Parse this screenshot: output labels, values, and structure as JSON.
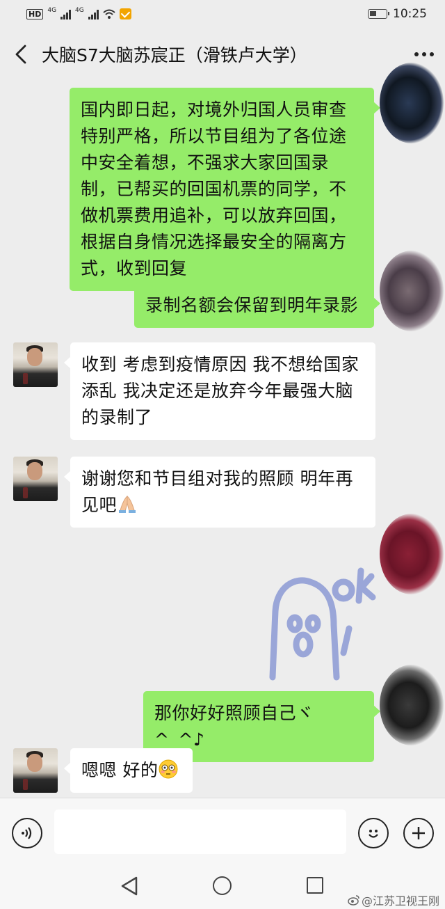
{
  "status_bar": {
    "hd": "HD",
    "hd_sub": "2",
    "net1": "4G",
    "net2": "4G",
    "time": "10:25"
  },
  "header": {
    "title": "大脑S7大脑苏宸正（滑铁卢大学）",
    "back_icon": "chevron-left-icon",
    "more_icon": "more-dots-icon"
  },
  "messages": [
    {
      "side": "right",
      "text": "国内即日起，对境外归国人员审查特别严格，所以节目组为了各位途中安全着想，不强求大家回国录制，已帮买的回国机票的同学，不做机票费用追补，可以放弃回国，根据自身情况选择最安全的隔离方式，收到回复"
    },
    {
      "side": "right",
      "text": "录制名额会保留到明年录影"
    },
    {
      "side": "left",
      "text": "收到 考虑到疫情原因 我不想给国家添乱 我决定还是放弃今年最强大脑的录制了"
    },
    {
      "side": "left",
      "text": "谢谢您和节目组对我的照顾 明年再见吧"
    },
    {
      "side": "right",
      "type": "sticker",
      "sticker_name": "ok-ghost-sticker"
    },
    {
      "side": "right",
      "text": "那你好好照顾自己ヾ ^_^♪"
    },
    {
      "side": "left",
      "text": "嗯嗯 好的"
    }
  ],
  "input_bar": {
    "voice_icon": "voice-icon",
    "emoji_icon": "emoji-icon",
    "plus_icon": "plus-icon",
    "placeholder": ""
  },
  "watermark": "@江苏卫视王刚",
  "colors": {
    "background": "#ededed",
    "bubble_right": "#95ec69",
    "bubble_left": "#ffffff"
  }
}
